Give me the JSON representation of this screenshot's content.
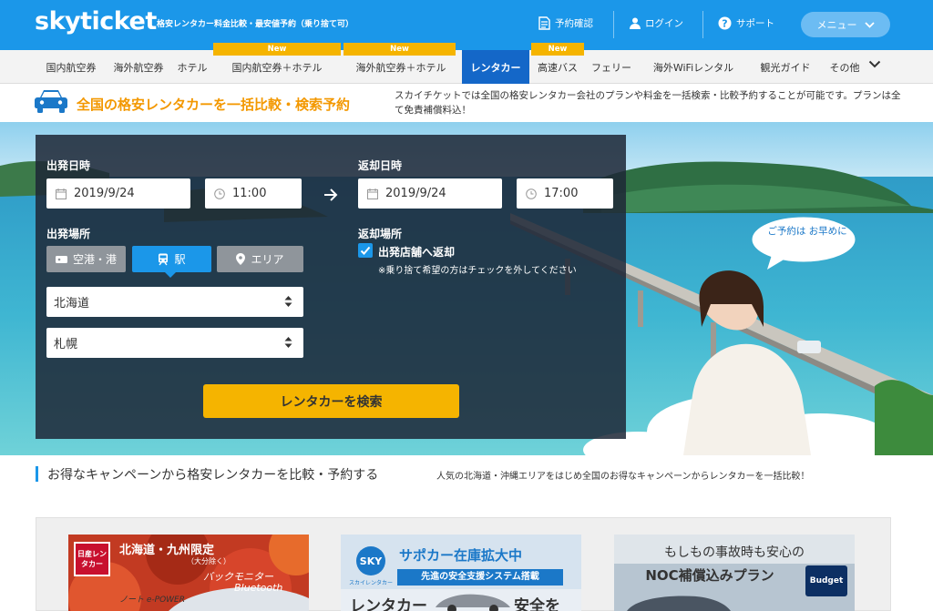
{
  "header": {
    "logo": "skyticket",
    "tagline": "格安レンタカー料金比較・最安値予約（乗り捨て可）",
    "reservation": "予約確認",
    "login": "ログイン",
    "support": "サポート",
    "menu": "メニュー"
  },
  "nav": {
    "items": [
      {
        "label": "国内航空券"
      },
      {
        "label": "海外航空券"
      },
      {
        "label": "ホテル"
      },
      {
        "label": "国内航空券＋ホテル"
      },
      {
        "label": "海外航空券＋ホテル"
      },
      {
        "label": "レンタカー"
      },
      {
        "label": "高速バス"
      },
      {
        "label": "フェリー"
      },
      {
        "label": "海外WiFiレンタル"
      },
      {
        "label": "観光ガイド"
      },
      {
        "label": "その他"
      }
    ],
    "new_badge": "New"
  },
  "subbar": {
    "title": "全国の格安レンタカーを一括比較・検索予約",
    "description": "スカイチケットでは全国の格安レンタカー会社のプランや料金を一括検索・比較予約することが可能です。プランは全て免責補償料込！"
  },
  "search": {
    "depart_label": "出発日時",
    "depart_date": "2019/9/24",
    "depart_time": "11:00",
    "return_label": "返却日時",
    "return_date": "2019/9/24",
    "return_time": "17:00",
    "depart_place_label": "出発場所",
    "segments": [
      "空港・港",
      "駅",
      "エリア"
    ],
    "prefecture": "北海道",
    "station": "札幌",
    "return_place_label": "返却場所",
    "return_same": "出発店舗へ返却",
    "return_note": "※乗り捨て希望の方はチェックを外してください",
    "button": "レンタカーを検索"
  },
  "hero": {
    "bubble_text": "ご予約は お早めに"
  },
  "campaign": {
    "title": "お得なキャンペーンから格安レンタカーを比較・予約する",
    "description": "人気の北海道・沖縄エリアをはじめ全国のお得なキャンペーンからレンタカーを一括比較！",
    "cards": [
      {
        "brand": "日産レンタカー",
        "headline": "北海道・九州限定",
        "sub": "（大分除く）",
        "feature": "バックモニター",
        "feature2": "Bluetooth",
        "model": "ノート e-POWER"
      },
      {
        "brand": "SKY RENT A CAR",
        "brand_sub": "スカイレンタカー",
        "headline": "サポカー在庫拡大中",
        "sub": "先進の安全支援システム搭載",
        "bottom": "レンタカー",
        "bottom2": "安全を"
      },
      {
        "headline": "もしもの事故時も安心の",
        "sub": "NOC補償込みプラン",
        "brand": "Budget"
      }
    ]
  },
  "colors": {
    "header_blue": "#1b97e9",
    "active_nav": "#1467c8",
    "accent_orange": "#f39800",
    "button_yellow": "#f5b400"
  }
}
